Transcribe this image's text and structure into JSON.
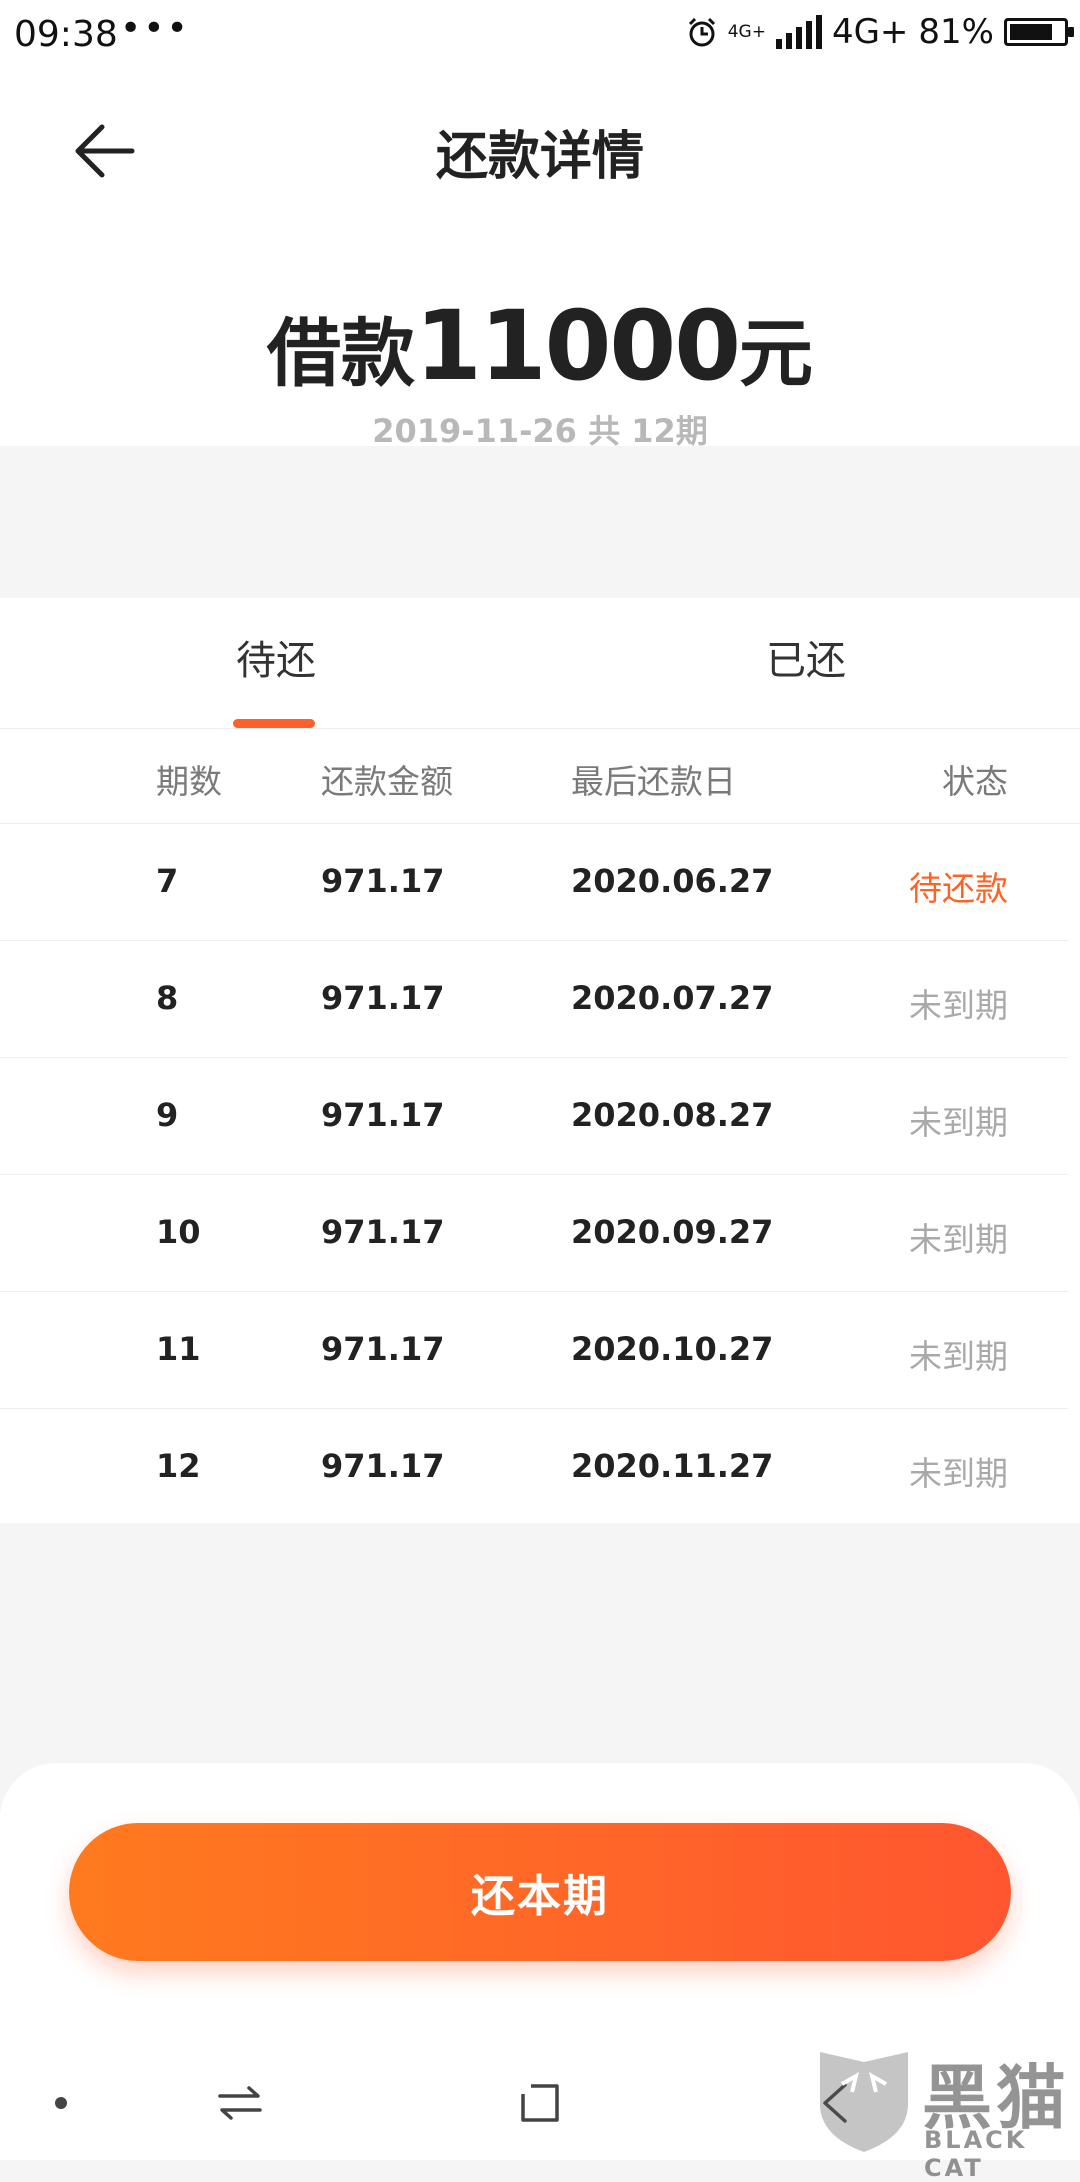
{
  "status_bar": {
    "time": "09:38",
    "more": "•••",
    "net_small": "4G+",
    "net": "4G+",
    "battery": "81%",
    "battery_level": 0.81
  },
  "header": {
    "title": "还款详情",
    "back_icon": "arrow-left-icon"
  },
  "summary": {
    "prefix": "借款",
    "amount": "11000",
    "suffix": "元",
    "subtitle": "2019-11-26 共 12期"
  },
  "tabs": [
    {
      "label": "待还",
      "active": true
    },
    {
      "label": "已还",
      "active": false
    }
  ],
  "table": {
    "headers": [
      "期数",
      "还款金额",
      "最后还款日",
      "状态"
    ],
    "rows": [
      {
        "period": "7",
        "amount": "971.17",
        "date": "2020.06.27",
        "status": "待还款"
      },
      {
        "period": "8",
        "amount": "971.17",
        "date": "2020.07.27",
        "status": "未到期"
      },
      {
        "period": "9",
        "amount": "971.17",
        "date": "2020.08.27",
        "status": "未到期"
      },
      {
        "period": "10",
        "amount": "971.17",
        "date": "2020.09.27",
        "status": "未到期"
      },
      {
        "period": "11",
        "amount": "971.17",
        "date": "2020.10.27",
        "status": "未到期"
      },
      {
        "period": "12",
        "amount": "971.17",
        "date": "2020.11.27",
        "status": "未到期"
      }
    ]
  },
  "action": {
    "pay_label": "还本期"
  },
  "colors": {
    "accent": "#ff5f2a",
    "button_start": "#ff7a1e",
    "button_end": "#ff5630",
    "pending_status": "#ff6324",
    "notdue_status": "#a9a9a9"
  },
  "watermark": {
    "text": "黑猫",
    "sub": "BLACK CAT"
  }
}
